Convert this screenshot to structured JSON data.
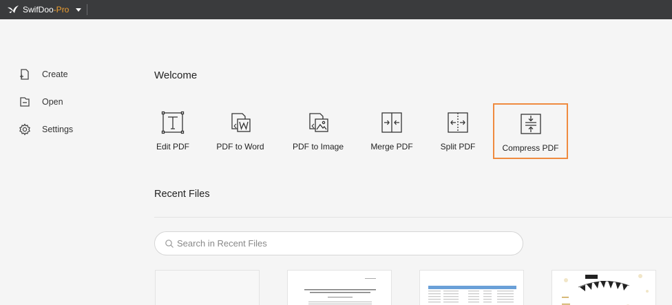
{
  "app": {
    "name_main": "SwifDoo",
    "name_suffix": "-Pro"
  },
  "sidebar": {
    "items": [
      {
        "label": "Create"
      },
      {
        "label": "Open"
      },
      {
        "label": "Settings"
      }
    ]
  },
  "welcome": {
    "title": "Welcome"
  },
  "tools": [
    {
      "label": "Edit PDF",
      "icon": "edit-pdf-icon"
    },
    {
      "label": "PDF to Word",
      "icon": "pdf-to-word-icon"
    },
    {
      "label": "PDF to Image",
      "icon": "pdf-to-image-icon"
    },
    {
      "label": "Merge PDF",
      "icon": "merge-pdf-icon"
    },
    {
      "label": "Split PDF",
      "icon": "split-pdf-icon"
    },
    {
      "label": "Compress PDF",
      "icon": "compress-pdf-icon"
    }
  ],
  "recent": {
    "title": "Recent Files",
    "search_placeholder": "Search in Recent Files"
  },
  "colors": {
    "titlebar": "#3a3b3d",
    "highlight": "#ef8a3e",
    "pro_accent": "#f0a030"
  }
}
